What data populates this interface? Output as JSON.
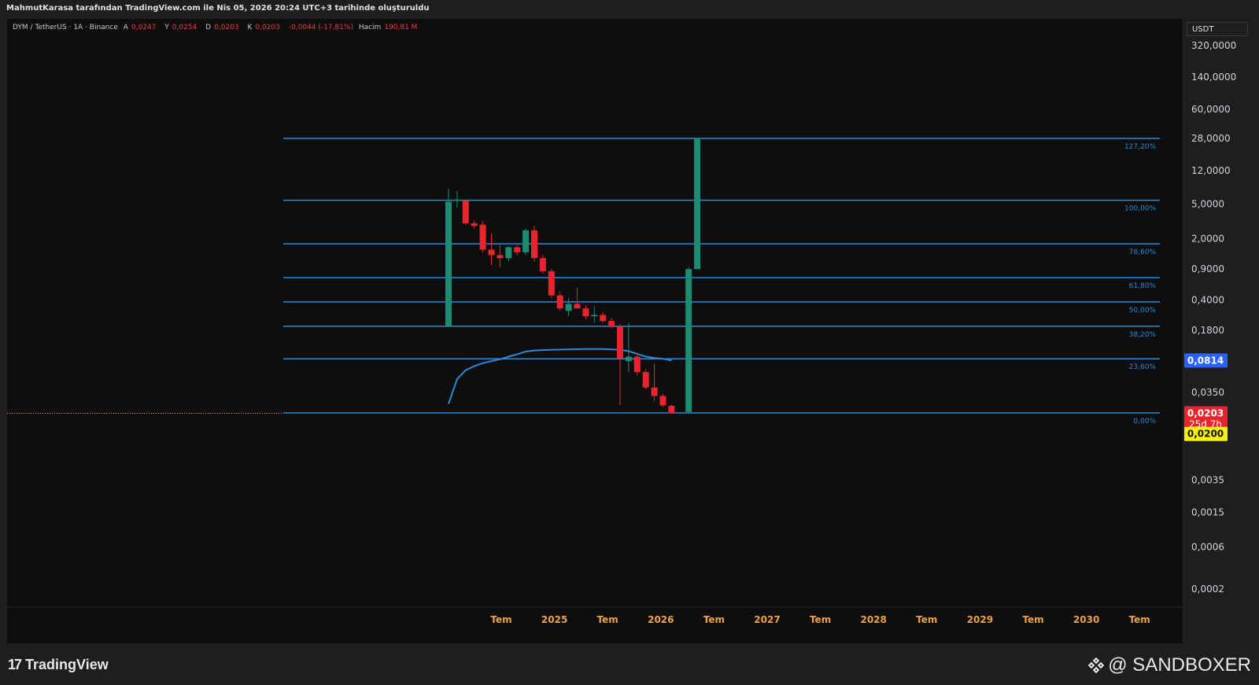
{
  "header": {
    "credit": "MahmutKarasa tarafından TradingView.com ile Nis 05, 2026 20:24 UTC+3 tarihinde oluşturuldu"
  },
  "legend": {
    "symbol": "DYM / TetherUS · 1A · Binance",
    "open_label": "A",
    "open_value": "0,0247",
    "high_label": "Y",
    "high_value": "0,0254",
    "low_label": "D",
    "low_value": "0,0203",
    "close_label": "K",
    "close_value": "0,0203",
    "change": "-0,0044 (-17,81%)",
    "volume_label": "Hacim",
    "volume_value": "190,81 M"
  },
  "price_axis": {
    "unit": "USDT"
  },
  "footer": {
    "brand": "TradingView",
    "watermark": "@ SANDBOXER"
  },
  "colors": {
    "up": "#1e8a70",
    "down": "#e8252e",
    "fib": "#2a8ad8",
    "ma": "#2a8ad8",
    "price_tag": "#e8252e",
    "price_line": "#e8a020",
    "tag_blue": "#2962ff",
    "tag_yellow": "#f5f10a"
  },
  "chart_data": {
    "type": "candlestick",
    "scale": "log",
    "ylim": [
      0.0001,
      500
    ],
    "x_axis_labels": [
      "Tem",
      "2025",
      "Tem",
      "2026",
      "Tem",
      "2027",
      "Tem",
      "2028",
      "Tem",
      "2029",
      "Tem",
      "2030",
      "Tem"
    ],
    "y_ticks": [
      {
        "v": 320,
        "label": "320,0000"
      },
      {
        "v": 140,
        "label": "140,0000"
      },
      {
        "v": 60,
        "label": "60,0000"
      },
      {
        "v": 28,
        "label": "28,0000"
      },
      {
        "v": 12,
        "label": "12,0000"
      },
      {
        "v": 5,
        "label": "5,0000"
      },
      {
        "v": 2,
        "label": "2,0000"
      },
      {
        "v": 0.9,
        "label": "0,9000"
      },
      {
        "v": 0.4,
        "label": "0,4000"
      },
      {
        "v": 0.18,
        "label": "0,1800"
      },
      {
        "v": 0.035,
        "label": "0,0350"
      },
      {
        "v": 0.0035,
        "label": "0,0035"
      },
      {
        "v": 0.0015,
        "label": "0,0015"
      },
      {
        "v": 0.0006,
        "label": "0,0006"
      },
      {
        "v": 0.0002,
        "label": "0,0002"
      }
    ],
    "fib_levels": [
      {
        "label": "127,20%",
        "v": 28
      },
      {
        "label": "100,00%",
        "v": 5.5
      },
      {
        "label": "78,60%",
        "v": 1.75
      },
      {
        "label": "61,80%",
        "v": 0.72
      },
      {
        "label": "50,00%",
        "v": 0.38
      },
      {
        "label": "38,20%",
        "v": 0.2
      },
      {
        "label": "23,60%",
        "v": 0.085
      },
      {
        "label": "0,00%",
        "v": 0.0205
      }
    ],
    "candles": [
      {
        "i": 0,
        "o": 0.2,
        "h": 7.5,
        "l": 0.2,
        "c": 5.3
      },
      {
        "i": 1,
        "o": 5.4,
        "h": 7.0,
        "l": 4.5,
        "c": 5.6
      },
      {
        "i": 2,
        "o": 5.5,
        "h": 5.5,
        "l": 2.9,
        "c": 3.0
      },
      {
        "i": 3,
        "o": 3.0,
        "h": 3.2,
        "l": 2.6,
        "c": 2.8
      },
      {
        "i": 4,
        "o": 2.9,
        "h": 3.2,
        "l": 1.4,
        "c": 1.5
      },
      {
        "i": 5,
        "o": 1.5,
        "h": 2.3,
        "l": 1.0,
        "c": 1.3
      },
      {
        "i": 6,
        "o": 1.3,
        "h": 1.7,
        "l": 0.95,
        "c": 1.2
      },
      {
        "i": 7,
        "o": 1.2,
        "h": 1.65,
        "l": 1.1,
        "c": 1.6
      },
      {
        "i": 8,
        "o": 1.6,
        "h": 1.7,
        "l": 1.3,
        "c": 1.4
      },
      {
        "i": 9,
        "o": 1.4,
        "h": 2.6,
        "l": 1.3,
        "c": 2.5
      },
      {
        "i": 10,
        "o": 2.5,
        "h": 2.8,
        "l": 1.1,
        "c": 1.2
      },
      {
        "i": 11,
        "o": 1.2,
        "h": 1.3,
        "l": 0.8,
        "c": 0.85
      },
      {
        "i": 12,
        "o": 0.85,
        "h": 0.9,
        "l": 0.42,
        "c": 0.45
      },
      {
        "i": 13,
        "o": 0.45,
        "h": 0.5,
        "l": 0.3,
        "c": 0.32
      },
      {
        "i": 14,
        "o": 0.3,
        "h": 0.42,
        "l": 0.26,
        "c": 0.36
      },
      {
        "i": 15,
        "o": 0.36,
        "h": 0.55,
        "l": 0.32,
        "c": 0.32
      },
      {
        "i": 16,
        "o": 0.32,
        "h": 0.35,
        "l": 0.24,
        "c": 0.26
      },
      {
        "i": 17,
        "o": 0.26,
        "h": 0.34,
        "l": 0.22,
        "c": 0.27
      },
      {
        "i": 18,
        "o": 0.27,
        "h": 0.29,
        "l": 0.22,
        "c": 0.23
      },
      {
        "i": 19,
        "o": 0.23,
        "h": 0.25,
        "l": 0.19,
        "c": 0.2
      },
      {
        "i": 20,
        "o": 0.2,
        "h": 0.21,
        "l": 0.025,
        "c": 0.085
      },
      {
        "i": 21,
        "o": 0.08,
        "h": 0.22,
        "l": 0.06,
        "c": 0.09
      },
      {
        "i": 22,
        "o": 0.09,
        "h": 0.1,
        "l": 0.055,
        "c": 0.06
      },
      {
        "i": 23,
        "o": 0.06,
        "h": 0.065,
        "l": 0.038,
        "c": 0.04
      },
      {
        "i": 24,
        "o": 0.04,
        "h": 0.075,
        "l": 0.028,
        "c": 0.032
      },
      {
        "i": 25,
        "o": 0.032,
        "h": 0.034,
        "l": 0.024,
        "c": 0.025
      },
      {
        "i": 26,
        "o": 0.0247,
        "h": 0.0254,
        "l": 0.0203,
        "c": 0.0203
      },
      {
        "i": 28,
        "o": 0.021,
        "h": 0.95,
        "l": 0.021,
        "c": 0.9
      },
      {
        "i": 29,
        "o": 0.9,
        "h": 28,
        "l": 0.9,
        "c": 28
      }
    ],
    "ma_line": [
      {
        "i": 0,
        "v": 0.026
      },
      {
        "i": 1,
        "v": 0.05
      },
      {
        "i": 2,
        "v": 0.063
      },
      {
        "i": 3,
        "v": 0.07
      },
      {
        "i": 4,
        "v": 0.076
      },
      {
        "i": 5,
        "v": 0.08
      },
      {
        "i": 6,
        "v": 0.084
      },
      {
        "i": 7,
        "v": 0.09
      },
      {
        "i": 8,
        "v": 0.096
      },
      {
        "i": 9,
        "v": 0.103
      },
      {
        "i": 10,
        "v": 0.106
      },
      {
        "i": 11,
        "v": 0.107
      },
      {
        "i": 12,
        "v": 0.108
      },
      {
        "i": 14,
        "v": 0.109
      },
      {
        "i": 16,
        "v": 0.11
      },
      {
        "i": 18,
        "v": 0.11
      },
      {
        "i": 20,
        "v": 0.108
      },
      {
        "i": 21,
        "v": 0.104
      },
      {
        "i": 22,
        "v": 0.097
      },
      {
        "i": 23,
        "v": 0.09
      },
      {
        "i": 24,
        "v": 0.087
      },
      {
        "i": 25,
        "v": 0.085
      },
      {
        "i": 26,
        "v": 0.0814
      }
    ],
    "price_tags": [
      {
        "label": "0,0814",
        "v": 0.0814,
        "color": "#2962ff",
        "text": "#ffffff"
      },
      {
        "label": "0,0203",
        "v": 0.0203,
        "color": "#e8252e",
        "text": "#ffffff",
        "sub": "25d 7h"
      },
      {
        "label": "0,0200",
        "v": 0.0118,
        "color": "#f5f10a",
        "text": "#111111"
      }
    ],
    "current_price": 0.0203
  }
}
